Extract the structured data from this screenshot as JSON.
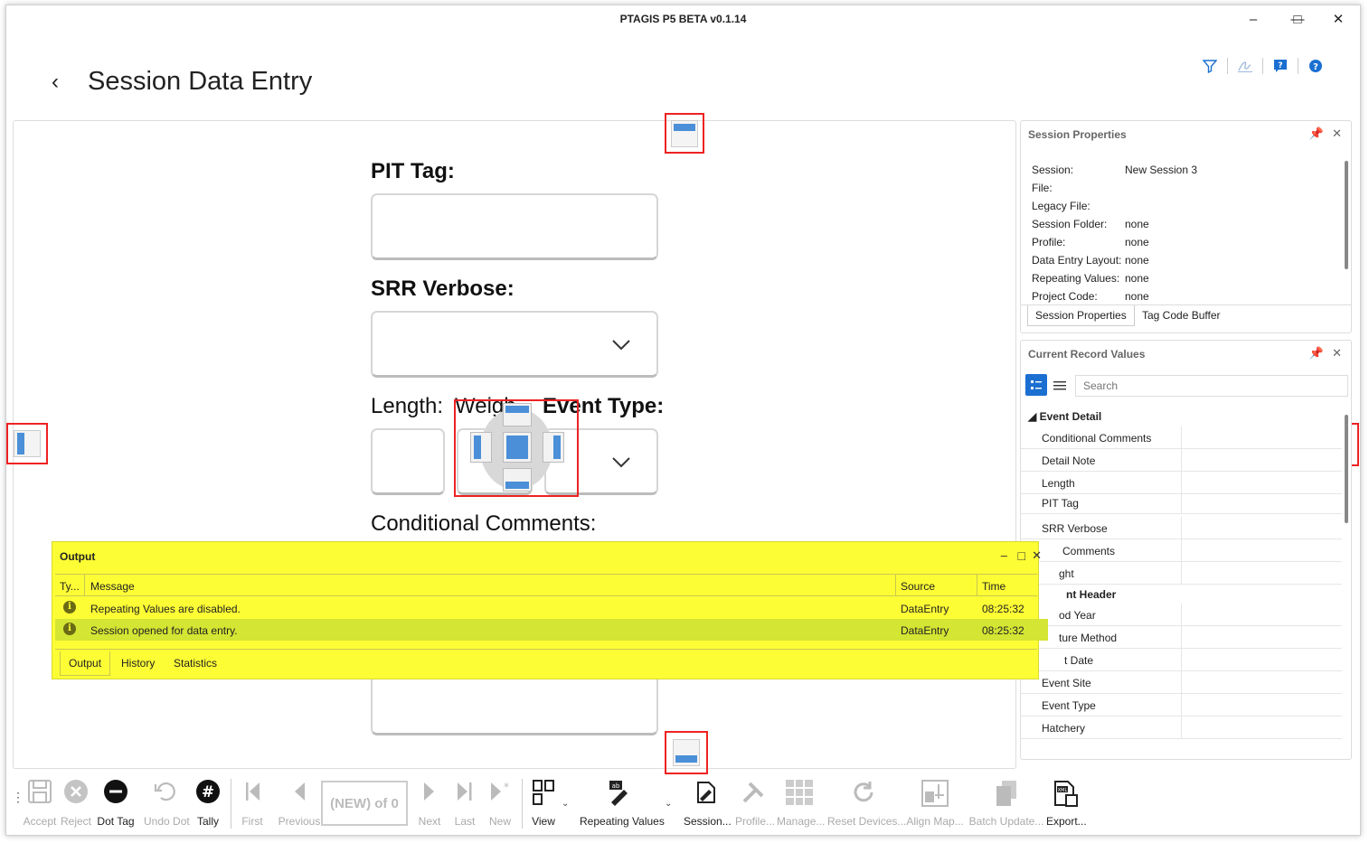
{
  "window": {
    "title": "PTAGIS P5 BETA v0.1.14"
  },
  "page": {
    "title": "Session Data Entry"
  },
  "form": {
    "pit_tag_label": "PIT Tag:",
    "srr_label": "SRR Verbose:",
    "length_label": "Length:",
    "weight_label": "Weigh",
    "event_type_label": "Event Type:",
    "conditional_comments_label": "Conditional Comments:"
  },
  "session_properties": {
    "title": "Session Properties",
    "rows": [
      {
        "key": "Session:",
        "value": "New Session 3"
      },
      {
        "key": "File:",
        "value": ""
      },
      {
        "key": "Legacy File:",
        "value": ""
      },
      {
        "key": "Session Folder:",
        "value": "none"
      },
      {
        "key": "Profile:",
        "value": "none"
      },
      {
        "key": "Data Entry Layout:",
        "value": "none"
      },
      {
        "key": "Repeating Values:",
        "value": "none"
      },
      {
        "key": "Project Code:",
        "value": "none"
      }
    ],
    "tabs": [
      "Session Properties",
      "Tag Code Buffer"
    ]
  },
  "current_record": {
    "title": "Current Record Values",
    "search_placeholder": "Search",
    "group1": "Event Detail",
    "group1_rows": [
      "Conditional Comments",
      "Detail Note",
      "Length",
      "PIT Tag",
      "SRR Verbose",
      "Comments",
      "ght"
    ],
    "group2": "nt Header",
    "group2_rows": [
      "od Year",
      "ture Method",
      "t Date",
      "Event Site",
      "Event Type",
      "Hatchery"
    ]
  },
  "output": {
    "title": "Output",
    "columns": [
      "Ty...",
      "Message",
      "Source",
      "Time"
    ],
    "rows": [
      {
        "message": "Repeating Values are disabled.",
        "source": "DataEntry",
        "time": "08:25:32"
      },
      {
        "message": "Session opened for data entry.",
        "source": "DataEntry",
        "time": "08:25:32"
      }
    ],
    "tabs": [
      "Output",
      "History",
      "Statistics"
    ]
  },
  "toolbar": {
    "accept": "Accept",
    "reject": "Reject",
    "dot_tag": "Dot Tag",
    "undo_dot": "Undo Dot",
    "tally": "Tally",
    "first": "First",
    "previous": "Previous",
    "record_pos": "(NEW) of 0",
    "next": "Next",
    "last": "Last",
    "new": "New",
    "view": "View",
    "repeating_values": "Repeating Values",
    "session": "Session...",
    "profile": "Profile...",
    "manage": "Manage...",
    "reset_devices": "Reset Devices...",
    "align_map": "Align Map...",
    "batch_update": "Batch Update...",
    "export": "Export..."
  },
  "colors": {
    "accent": "#1a6fd1",
    "output_bg": "#fdfd35",
    "output_sel": "#d4e533",
    "dock_blue": "#4a8fd8"
  }
}
